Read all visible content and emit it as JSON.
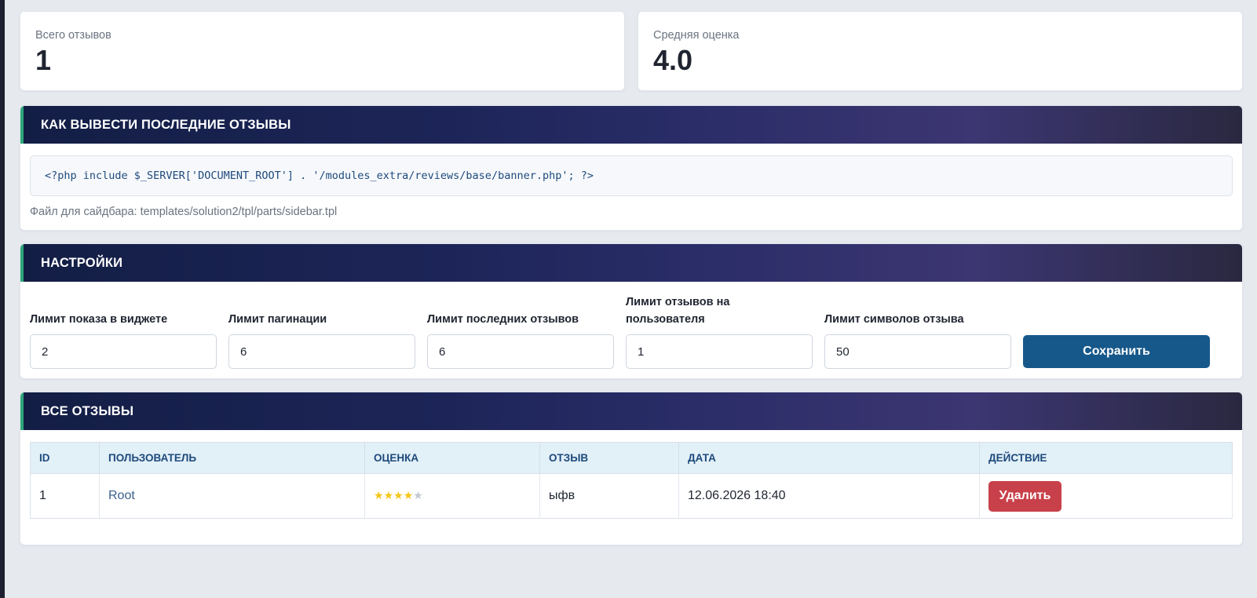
{
  "stats": {
    "total_label": "Всего отзывов",
    "total_value": "1",
    "avg_label": "Средняя оценка",
    "avg_value": "4.0"
  },
  "embed_panel": {
    "title": "КАК ВЫВЕСТИ ПОСЛЕДНИЕ ОТЗЫВЫ",
    "code": "<?php include $_SERVER['DOCUMENT_ROOT'] . '/modules_extra/reviews/base/banner.php'; ?>",
    "note": "Файл для сайдбара: templates/solution2/tpl/parts/sidebar.tpl"
  },
  "settings_panel": {
    "title": "НАСТРОЙКИ",
    "widget_limit_label": "Лимит показа в виджете",
    "widget_limit_value": "2",
    "pagination_limit_label": "Лимит пагинации",
    "pagination_limit_value": "6",
    "recent_limit_label": "Лимит последних отзывов",
    "recent_limit_value": "6",
    "per_user_limit_label_line1": "Лимит отзывов на",
    "per_user_limit_label_line2": "пользователя",
    "per_user_limit_value": "1",
    "chars_limit_label": "Лимит символов отзыва",
    "chars_limit_value": "50",
    "save_label": "Сохранить"
  },
  "reviews_panel": {
    "title": "ВСЕ ОТЗЫВЫ",
    "columns": [
      "ID",
      "ПОЛЬЗОВАТЕЛЬ",
      "ОЦЕНКА",
      "ОТЗЫВ",
      "ДАТА",
      "ДЕЙСТВИЕ"
    ],
    "rows": [
      {
        "id": "1",
        "user": "Root",
        "rating": 4,
        "rating_max": 5,
        "text": "ыфв",
        "date": "12.06.2026 18:40",
        "action_label": "Удалить"
      }
    ]
  },
  "colors": {
    "accent_green": "#2fa67a",
    "header_gradient_start": "#131e45",
    "save_button": "#17588a",
    "delete_button": "#c8414a",
    "star_filled": "#f5c518",
    "star_empty": "#c3c9d2"
  },
  "icons": {
    "star_filled": "star-icon",
    "star_empty": "star-empty-icon"
  }
}
